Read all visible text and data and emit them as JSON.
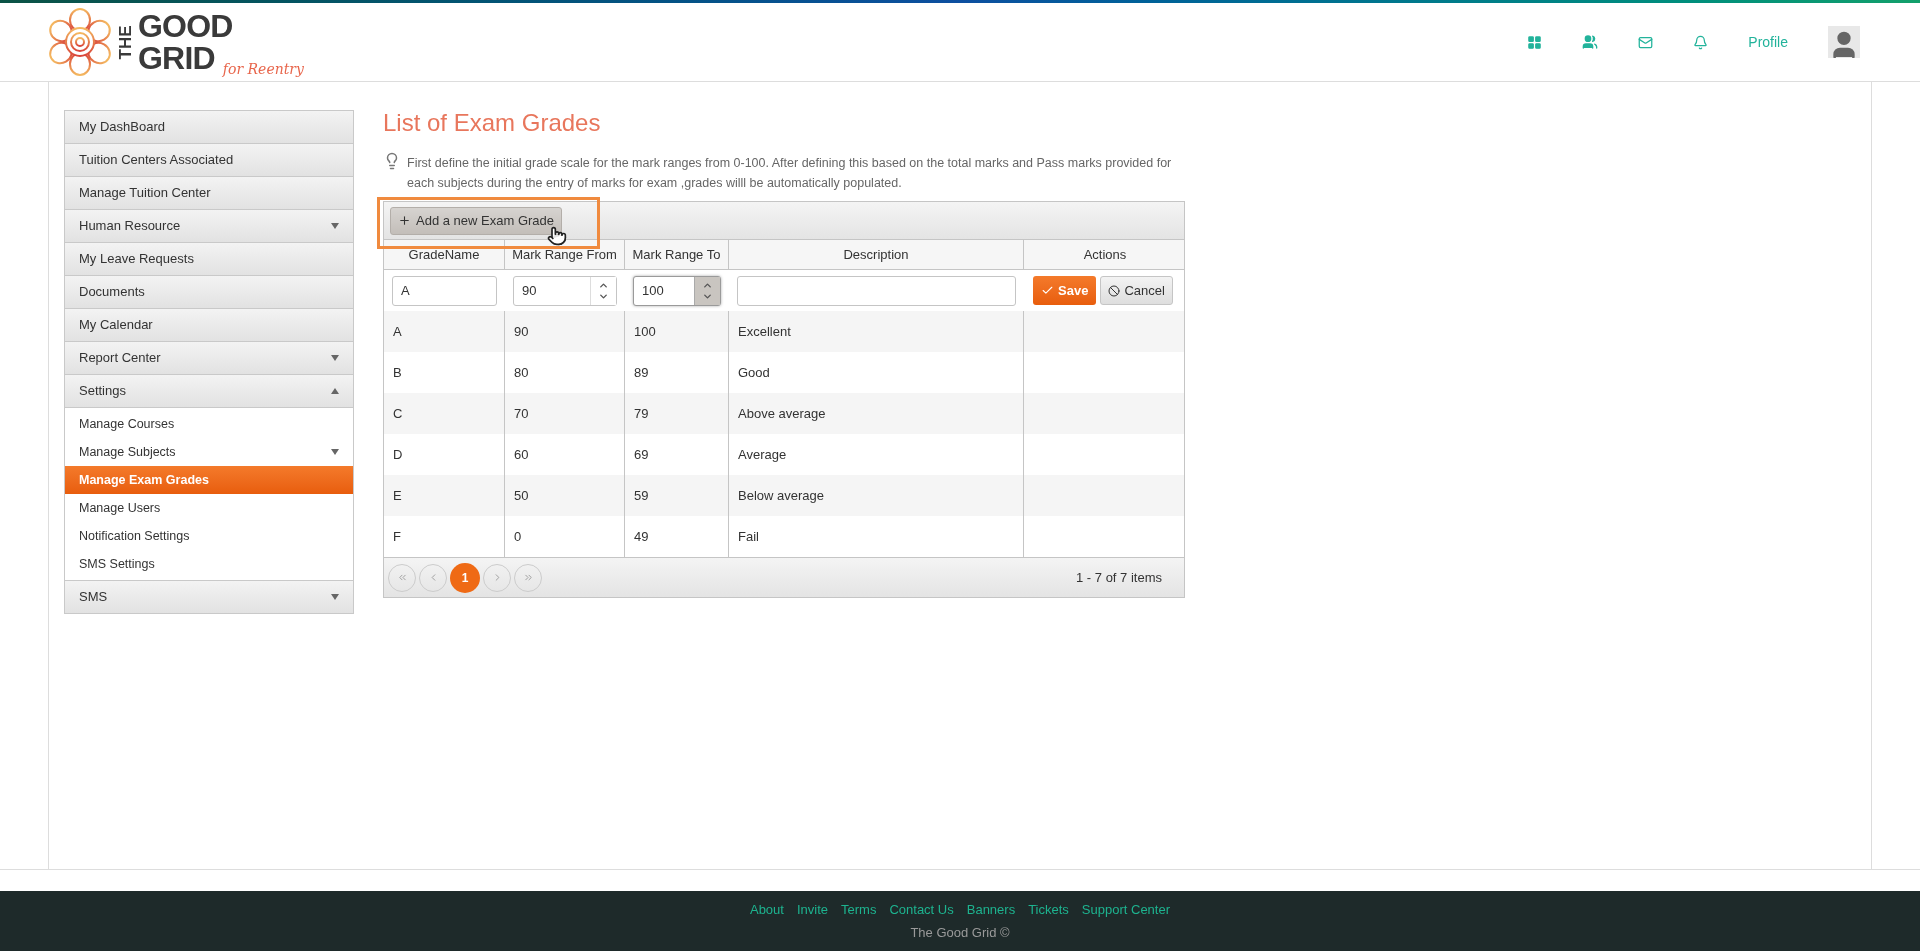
{
  "header": {
    "logo": {
      "the": "THE",
      "good": "GOOD",
      "grid": "GRID",
      "tagline": "for Reentry"
    },
    "profile_link": "Profile"
  },
  "sidebar": {
    "items": [
      {
        "label": "My DashBoard",
        "selected": false
      },
      {
        "label": "Tuition Centers Associated",
        "selected": false
      },
      {
        "label": "Manage Tuition Center",
        "selected": false
      },
      {
        "label": "Human Resource",
        "selected": false,
        "expanded": false
      },
      {
        "label": "My Leave Requests",
        "selected": false
      },
      {
        "label": "Documents",
        "selected": false
      },
      {
        "label": "My Calendar",
        "selected": false
      },
      {
        "label": "Report Center",
        "selected": false,
        "expanded": false
      },
      {
        "label": "Settings",
        "selected": false,
        "expanded": true,
        "children": [
          {
            "label": "Manage Courses",
            "selected": false
          },
          {
            "label": "Manage Subjects",
            "selected": false,
            "expanded": false
          },
          {
            "label": "Manage Exam Grades",
            "selected": true
          },
          {
            "label": "Manage Users",
            "selected": false
          },
          {
            "label": "Notification Settings",
            "selected": false
          },
          {
            "label": "SMS Settings",
            "selected": false
          }
        ]
      },
      {
        "label": "SMS",
        "selected": false,
        "expanded": false
      }
    ]
  },
  "page": {
    "title": "List of Exam Grades",
    "hint": "First define the initial grade scale for the mark ranges from 0-100. After defining this based on the total marks and Pass marks provided for each subjects during the entry of marks for exam ,grades willl be automatically populated."
  },
  "grid": {
    "add_button": "Add a new Exam Grade",
    "columns": [
      "GradeName",
      "Mark Range From",
      "Mark Range To",
      "Description",
      "Actions"
    ],
    "edit_row": {
      "grade_name": "A",
      "from": {
        "value": "90",
        "focused": false
      },
      "to": {
        "value": "100",
        "focused": true
      },
      "save": "Save",
      "cancel": "Cancel"
    },
    "rows": [
      {
        "grade": "A",
        "from": "90",
        "to": "100",
        "description": "Excellent"
      },
      {
        "grade": "B",
        "from": "80",
        "to": "89",
        "description": "Good"
      },
      {
        "grade": "C",
        "from": "70",
        "to": "79",
        "description": "Above average"
      },
      {
        "grade": "D",
        "from": "60",
        "to": "69",
        "description": "Average"
      },
      {
        "grade": "E",
        "from": "50",
        "to": "59",
        "description": "Below average"
      },
      {
        "grade": "F",
        "from": "0",
        "to": "49",
        "description": "Fail"
      }
    ],
    "pager": {
      "pages": [
        {
          "label": "1",
          "selected": true
        }
      ],
      "info": "1 - 7 of 7 items"
    }
  },
  "footer": {
    "links": [
      "About",
      "Invite",
      "Terms",
      "Contact Us",
      "Banners",
      "Tickets",
      "Support Center"
    ],
    "copyright": "The Good Grid ©"
  }
}
